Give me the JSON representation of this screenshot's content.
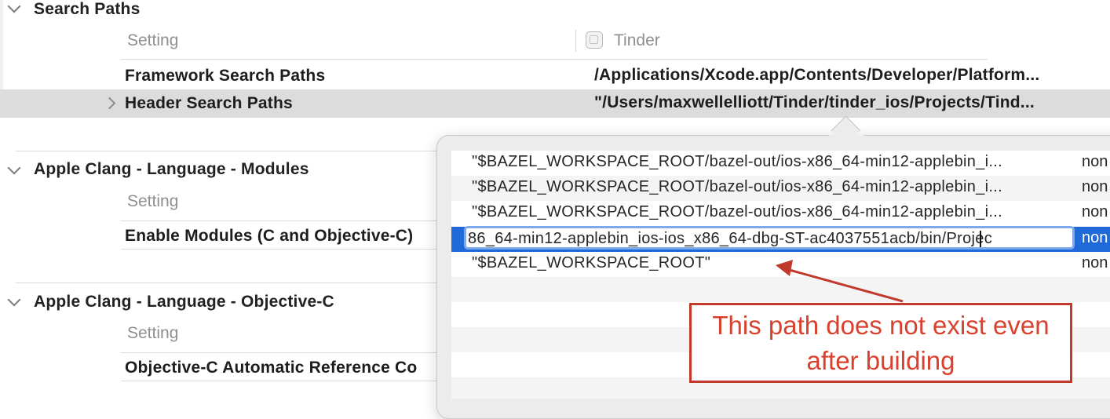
{
  "sections": [
    {
      "title": "Search Paths",
      "header": {
        "setting": "Setting",
        "target": "Tinder"
      },
      "rows": [
        {
          "name": "Framework Search Paths",
          "value": "/Applications/Xcode.app/Contents/Developer/Platform..."
        },
        {
          "name": "Header Search Paths",
          "value": "\"/Users/maxwellelliott/Tinder/tinder_ios/Projects/Tind..."
        }
      ]
    },
    {
      "title": "Apple Clang - Language - Modules",
      "header": {
        "setting": "Setting"
      },
      "rows": [
        {
          "name": "Enable Modules (C and Objective-C)"
        }
      ]
    },
    {
      "title": "Apple Clang - Language - Objective-C",
      "header": {
        "setting": "Setting"
      },
      "rows": [
        {
          "name": "Objective-C Automatic Reference Co"
        }
      ]
    }
  ],
  "popover": {
    "rows": [
      {
        "path": "\"$BAZEL_WORKSPACE_ROOT/bazel-out/ios-x86_64-min12-applebin_i...",
        "type": "non"
      },
      {
        "path": "\"$BAZEL_WORKSPACE_ROOT/bazel-out/ios-x86_64-min12-applebin_i...",
        "type": "non"
      },
      {
        "path": "\"$BAZEL_WORKSPACE_ROOT/bazel-out/ios-x86_64-min12-applebin_i...",
        "type": "non"
      },
      {
        "path": "86_64-min12-applebin_ios-ios_x86_64-dbg-ST-ac4037551acb/bin/Projec",
        "type": "non",
        "editing": true
      },
      {
        "path": "\"$BAZEL_WORKSPACE_ROOT\"",
        "type": "non"
      }
    ]
  },
  "annotation": {
    "text": "This path does not exist even after building",
    "color": "#d9412e"
  }
}
